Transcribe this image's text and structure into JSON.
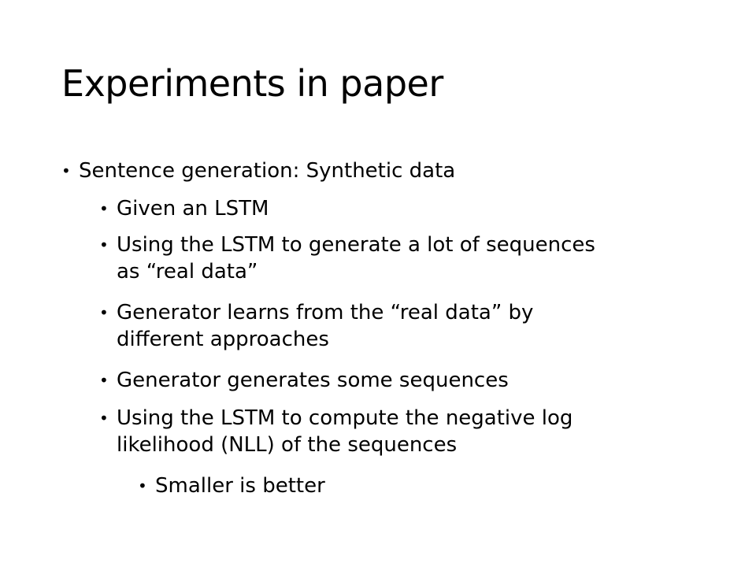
{
  "slide": {
    "title": "Experiments in paper",
    "bullets": {
      "b1": "Sentence generation: Synthetic data",
      "b2": "Given an LSTM",
      "b3_line1": "Using the LSTM to generate a lot of sequences",
      "b3_line2": "as “real data”",
      "b4_line1": "Generator learns from the “real data” by",
      "b4_line2": "different approaches",
      "b5": "Generator generates some sequences",
      "b6_line1": "Using the LSTM to compute the negative log",
      "b6_line2": "likelihood (NLL) of the sequences",
      "b7": "Smaller is better"
    },
    "bullet_glyph": "•"
  }
}
